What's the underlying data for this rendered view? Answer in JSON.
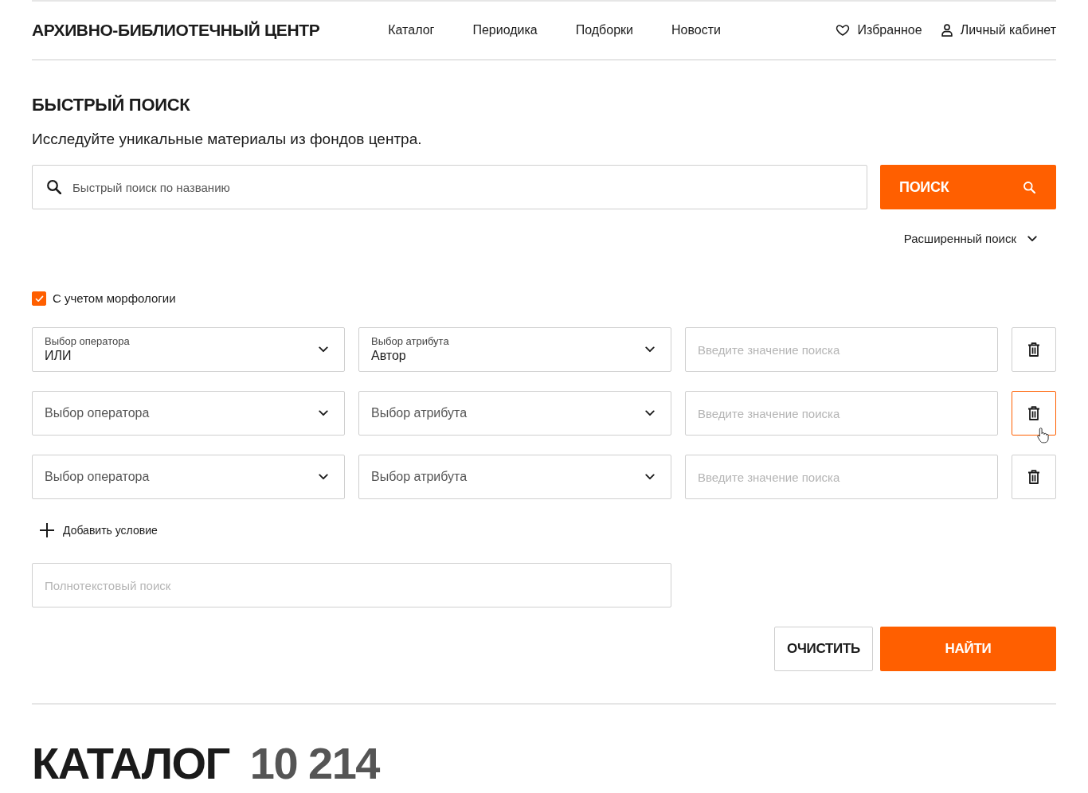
{
  "header": {
    "logo": "АРХИВНО-БИБЛИОТЕЧНЫЙ ЦЕНТР",
    "nav": [
      {
        "label": "Каталог"
      },
      {
        "label": "Периодика"
      },
      {
        "label": "Подборки"
      },
      {
        "label": "Новости"
      }
    ],
    "actions": [
      {
        "kind": "favorites",
        "label": "Избранное"
      },
      {
        "kind": "account",
        "label": "Личный кабинет"
      }
    ]
  },
  "quick_search": {
    "title": "БЫСТРЫЙ ПОИСК",
    "subtitle": "Исследуйте уникальные материалы из фондов центра.",
    "search_field": {
      "placeholder": "Быстрый поиск по названию"
    },
    "search_button": "ПОИСК",
    "advanced_toggle": {
      "label": "Расширенный поиск",
      "expanded": true
    }
  },
  "advanced": {
    "morphology": {
      "label": "С учетом морфологии",
      "checked": true
    },
    "conditions": [
      {
        "operator": {
          "label": "Выбор оператора",
          "value": "ИЛИ"
        },
        "attribute": {
          "label": "Выбор атрибута",
          "value": "Автор"
        },
        "value_placeholder": "Введите значение поиска",
        "delete_hovered": false
      },
      {
        "operator": {
          "placeholder": "Выбор оператора"
        },
        "attribute": {
          "placeholder": "Выбор атрибута"
        },
        "value_placeholder": "Введите значение поиска",
        "delete_hovered": true
      },
      {
        "operator": {
          "placeholder": "Выбор оператора"
        },
        "attribute": {
          "placeholder": "Выбор атрибута"
        },
        "value_placeholder": "Введите значение поиска",
        "delete_hovered": false
      }
    ],
    "add_condition": "Добавить условие",
    "fulltext": {
      "placeholder": "Полнотекстовый поиск"
    },
    "buttons": [
      {
        "kind": "secondary",
        "label": "ОЧИСТИТЬ"
      },
      {
        "kind": "primary",
        "label": "НАЙТИ"
      }
    ]
  },
  "catalog": {
    "title": "КАТАЛОГ",
    "count": "10 214"
  }
}
